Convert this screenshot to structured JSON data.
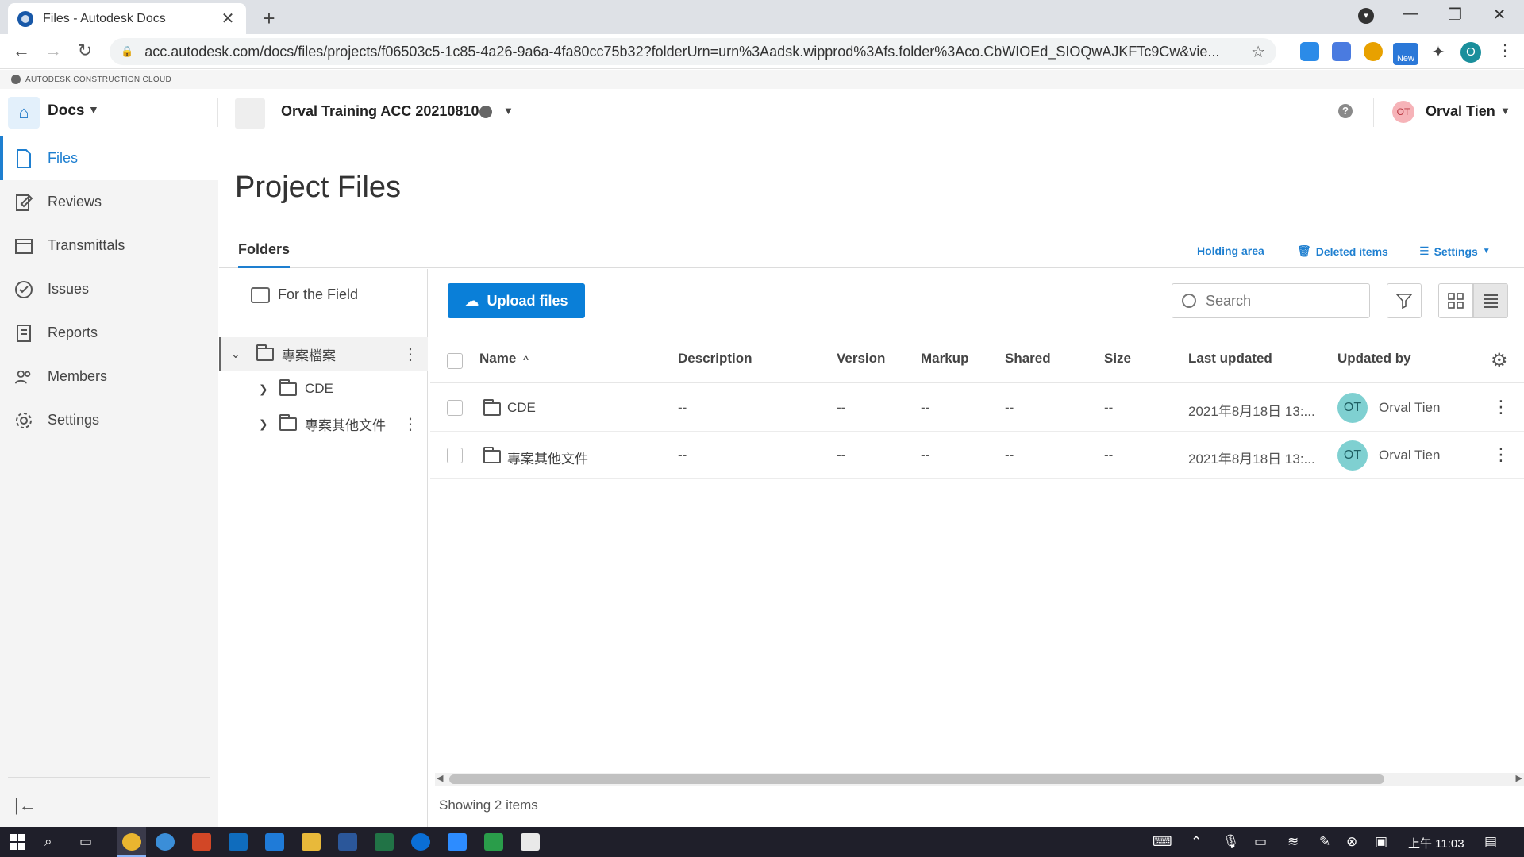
{
  "browser": {
    "tab_title": "Files - Autodesk Docs",
    "tab_close": "✕",
    "new_tab": "+",
    "url": "acc.autodesk.com/docs/files/projects/f06503c5-1c85-4a26-9a6a-4fa80cc75b32?folderUrn=urn%3Aadsk.wipprod%3Afs.folder%3Aco.CbWIOEd_SIOQwAJKFTc9Cw&vie...",
    "profile_initial": "O",
    "ext_new_label": "New",
    "minimize": "—",
    "restore": "❐",
    "close": "✕"
  },
  "acc_banner": "AUTODESK CONSTRUCTION CLOUD",
  "header": {
    "product": "Docs",
    "project_name": "Orval Training ACC 20210810",
    "user_initials": "OT",
    "user_name": "Orval Tien",
    "help": "?"
  },
  "nav": {
    "items": [
      {
        "label": "Files",
        "icon": "file-icon"
      },
      {
        "label": "Reviews",
        "icon": "reviews-icon"
      },
      {
        "label": "Transmittals",
        "icon": "transmittals-icon"
      },
      {
        "label": "Issues",
        "icon": "issues-icon"
      },
      {
        "label": "Reports",
        "icon": "reports-icon"
      },
      {
        "label": "Members",
        "icon": "members-icon"
      },
      {
        "label": "Settings",
        "icon": "settings-icon"
      }
    ],
    "collapse": "|←"
  },
  "page": {
    "title": "Project Files",
    "tab_folders": "Folders",
    "holding_area": "Holding area",
    "deleted_items": "Deleted items",
    "settings": "Settings"
  },
  "tree": {
    "for_the_field": "For the Field",
    "root": "專案檔案",
    "children": [
      "CDE",
      "專案其他文件"
    ]
  },
  "toolbar": {
    "upload": "Upload files",
    "search_placeholder": "Search"
  },
  "table": {
    "columns": [
      "Name",
      "Description",
      "Version",
      "Markup",
      "Shared",
      "Size",
      "Last updated",
      "Updated by"
    ],
    "sort_indicator": "^",
    "rows": [
      {
        "name": "CDE",
        "description": "--",
        "version": "--",
        "markup": "--",
        "shared": "--",
        "size": "--",
        "last_updated": "2021年8月18日 13:...",
        "updated_by_initials": "OT",
        "updated_by": "Orval Tien"
      },
      {
        "name": "專案其他文件",
        "description": "--",
        "version": "--",
        "markup": "--",
        "shared": "--",
        "size": "--",
        "last_updated": "2021年8月18日 13:...",
        "updated_by_initials": "OT",
        "updated_by": "Orval Tien"
      }
    ],
    "footer": "Showing 2 items"
  },
  "taskbar": {
    "clock": "上午 11:03"
  },
  "colors": {
    "accent": "#0a7fd8",
    "nav_active": "#1e7fd0",
    "avatar_teal": "#7fd0d1",
    "avatar_pink": "#f6b3b8"
  }
}
